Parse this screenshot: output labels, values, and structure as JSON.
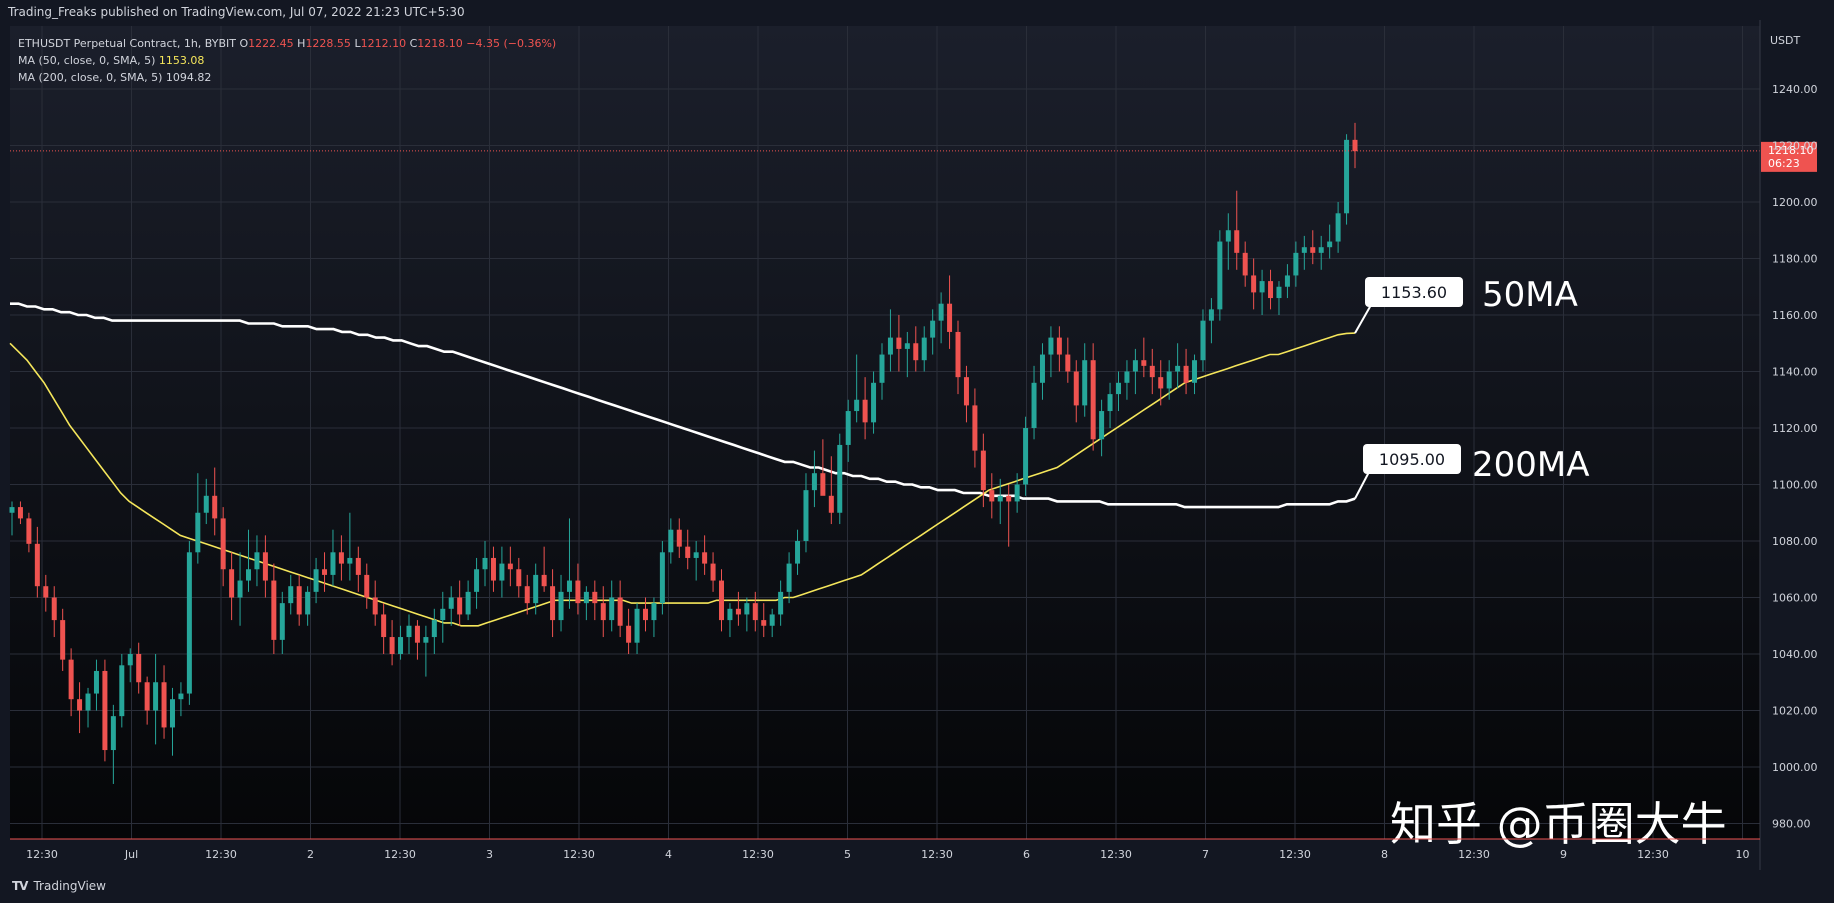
{
  "header": {
    "published": "Trading_Freaks published on TradingView.com, Jul 07, 2022 21:23 UTC+5:30"
  },
  "legend": {
    "symbol": "ETHUSDT Perpetual Contract, 1h, BYBIT",
    "o_label": "O",
    "o": "1222.45",
    "h_label": "H",
    "h": "1228.55",
    "l_label": "L",
    "l": "1212.10",
    "c_label": "C",
    "c": "1218.10",
    "change": "−4.35 (−0.36%)",
    "ma50_label": "MA (50, close, 0, SMA, 5)",
    "ma50_value": "1153.08",
    "ma200_label": "MA (200, close, 0, SMA, 5)",
    "ma200_value": "1094.82"
  },
  "footer": {
    "brand": "TradingView"
  },
  "watermark": "知乎 @币圈大牛",
  "colors": {
    "background": "#131722",
    "up": "#26a69a",
    "down": "#ef5350",
    "ma50": "#f5e65b",
    "ma200": "#ffffff",
    "grid": "#2a2e39",
    "price_label_bg": "#ef5350"
  },
  "chart_data": {
    "type": "candlestick",
    "title": "ETHUSDT Perpetual Contract, 1h, BYBIT",
    "currency": "USDT",
    "ylim": [
      980,
      1240
    ],
    "y_ticks": [
      "1240.00",
      "1220.00",
      "1200.00",
      "1180.00",
      "1160.00",
      "1140.00",
      "1120.00",
      "1100.00",
      "1080.00",
      "1060.00",
      "1040.00",
      "1020.00",
      "1000.00",
      "980.00"
    ],
    "x_ticks": [
      "12:30",
      "Jul",
      "12:30",
      "2",
      "12:30",
      "3",
      "12:30",
      "4",
      "12:30",
      "5",
      "12:30",
      "6",
      "12:30",
      "7",
      "12:30",
      "8",
      "12:30",
      "9",
      "12:30",
      "10"
    ],
    "last_price": {
      "value": "1218.10",
      "countdown": "06:23"
    },
    "grid": true,
    "candles": [
      [
        1090,
        1094,
        1082,
        1092
      ],
      [
        1092,
        1094,
        1086,
        1088
      ],
      [
        1088,
        1090,
        1076,
        1079
      ],
      [
        1079,
        1085,
        1060,
        1064
      ],
      [
        1064,
        1068,
        1055,
        1060
      ],
      [
        1060,
        1064,
        1046,
        1052
      ],
      [
        1052,
        1056,
        1034,
        1038
      ],
      [
        1038,
        1042,
        1018,
        1024
      ],
      [
        1024,
        1030,
        1012,
        1020
      ],
      [
        1020,
        1028,
        1014,
        1026
      ],
      [
        1026,
        1038,
        1020,
        1034
      ],
      [
        1034,
        1038,
        1002,
        1006
      ],
      [
        1006,
        1022,
        994,
        1018
      ],
      [
        1018,
        1040,
        1014,
        1036
      ],
      [
        1036,
        1042,
        1030,
        1040
      ],
      [
        1040,
        1044,
        1026,
        1030
      ],
      [
        1030,
        1032,
        1015,
        1020
      ],
      [
        1020,
        1040,
        1008,
        1030
      ],
      [
        1030,
        1036,
        1010,
        1014
      ],
      [
        1014,
        1028,
        1004,
        1024
      ],
      [
        1024,
        1030,
        1018,
        1026
      ],
      [
        1026,
        1080,
        1022,
        1076
      ],
      [
        1076,
        1104,
        1072,
        1090
      ],
      [
        1090,
        1102,
        1086,
        1096
      ],
      [
        1096,
        1106,
        1082,
        1088
      ],
      [
        1088,
        1092,
        1064,
        1070
      ],
      [
        1070,
        1076,
        1052,
        1060
      ],
      [
        1060,
        1076,
        1050,
        1066
      ],
      [
        1066,
        1084,
        1062,
        1070
      ],
      [
        1070,
        1082,
        1064,
        1076
      ],
      [
        1076,
        1082,
        1060,
        1066
      ],
      [
        1066,
        1072,
        1040,
        1045
      ],
      [
        1045,
        1062,
        1040,
        1058
      ],
      [
        1058,
        1068,
        1054,
        1064
      ],
      [
        1064,
        1068,
        1050,
        1054
      ],
      [
        1054,
        1064,
        1050,
        1062
      ],
      [
        1062,
        1074,
        1058,
        1070
      ],
      [
        1070,
        1076,
        1062,
        1068
      ],
      [
        1068,
        1084,
        1064,
        1076
      ],
      [
        1076,
        1082,
        1066,
        1072
      ],
      [
        1072,
        1090,
        1066,
        1074
      ],
      [
        1074,
        1078,
        1062,
        1068
      ],
      [
        1068,
        1072,
        1056,
        1060
      ],
      [
        1060,
        1066,
        1050,
        1054
      ],
      [
        1054,
        1058,
        1040,
        1046
      ],
      [
        1046,
        1052,
        1036,
        1040
      ],
      [
        1040,
        1050,
        1038,
        1046
      ],
      [
        1046,
        1054,
        1040,
        1050
      ],
      [
        1050,
        1052,
        1038,
        1044
      ],
      [
        1044,
        1050,
        1032,
        1046
      ],
      [
        1046,
        1056,
        1040,
        1052
      ],
      [
        1052,
        1062,
        1044,
        1056
      ],
      [
        1056,
        1064,
        1050,
        1060
      ],
      [
        1060,
        1066,
        1050,
        1054
      ],
      [
        1054,
        1066,
        1052,
        1062
      ],
      [
        1062,
        1074,
        1056,
        1070
      ],
      [
        1070,
        1080,
        1064,
        1074
      ],
      [
        1074,
        1078,
        1062,
        1066
      ],
      [
        1066,
        1078,
        1060,
        1072
      ],
      [
        1072,
        1078,
        1064,
        1070
      ],
      [
        1070,
        1074,
        1060,
        1064
      ],
      [
        1064,
        1068,
        1054,
        1058
      ],
      [
        1058,
        1072,
        1054,
        1068
      ],
      [
        1068,
        1078,
        1062,
        1064
      ],
      [
        1064,
        1070,
        1046,
        1052
      ],
      [
        1052,
        1068,
        1048,
        1062
      ],
      [
        1062,
        1088,
        1056,
        1066
      ],
      [
        1066,
        1072,
        1054,
        1058
      ],
      [
        1058,
        1064,
        1052,
        1062
      ],
      [
        1062,
        1066,
        1052,
        1058
      ],
      [
        1058,
        1064,
        1046,
        1052
      ],
      [
        1052,
        1066,
        1048,
        1060
      ],
      [
        1060,
        1066,
        1046,
        1050
      ],
      [
        1050,
        1056,
        1040,
        1044
      ],
      [
        1044,
        1058,
        1040,
        1056
      ],
      [
        1056,
        1060,
        1048,
        1052
      ],
      [
        1052,
        1060,
        1046,
        1058
      ],
      [
        1058,
        1080,
        1054,
        1076
      ],
      [
        1076,
        1088,
        1072,
        1084
      ],
      [
        1084,
        1088,
        1074,
        1078
      ],
      [
        1078,
        1084,
        1070,
        1074
      ],
      [
        1074,
        1080,
        1066,
        1076
      ],
      [
        1076,
        1082,
        1068,
        1072
      ],
      [
        1072,
        1076,
        1062,
        1066
      ],
      [
        1066,
        1070,
        1048,
        1052
      ],
      [
        1052,
        1058,
        1046,
        1056
      ],
      [
        1056,
        1062,
        1050,
        1054
      ],
      [
        1054,
        1060,
        1048,
        1058
      ],
      [
        1058,
        1062,
        1048,
        1052
      ],
      [
        1052,
        1058,
        1046,
        1050
      ],
      [
        1050,
        1056,
        1046,
        1054
      ],
      [
        1054,
        1066,
        1050,
        1062
      ],
      [
        1062,
        1076,
        1058,
        1072
      ],
      [
        1072,
        1084,
        1068,
        1080
      ],
      [
        1080,
        1104,
        1076,
        1098
      ],
      [
        1098,
        1112,
        1092,
        1104
      ],
      [
        1104,
        1116,
        1098,
        1096
      ],
      [
        1096,
        1110,
        1086,
        1090
      ],
      [
        1090,
        1118,
        1086,
        1114
      ],
      [
        1114,
        1130,
        1108,
        1126
      ],
      [
        1126,
        1146,
        1122,
        1130
      ],
      [
        1130,
        1138,
        1116,
        1122
      ],
      [
        1122,
        1140,
        1118,
        1136
      ],
      [
        1136,
        1150,
        1130,
        1146
      ],
      [
        1146,
        1162,
        1140,
        1152
      ],
      [
        1152,
        1160,
        1140,
        1148
      ],
      [
        1148,
        1154,
        1138,
        1150
      ],
      [
        1150,
        1156,
        1140,
        1144
      ],
      [
        1144,
        1156,
        1140,
        1152
      ],
      [
        1152,
        1162,
        1146,
        1158
      ],
      [
        1158,
        1168,
        1150,
        1164
      ],
      [
        1164,
        1174,
        1148,
        1154
      ],
      [
        1154,
        1158,
        1132,
        1138
      ],
      [
        1138,
        1142,
        1122,
        1128
      ],
      [
        1128,
        1134,
        1106,
        1112
      ],
      [
        1112,
        1118,
        1092,
        1098
      ],
      [
        1098,
        1104,
        1088,
        1094
      ],
      [
        1094,
        1102,
        1086,
        1096
      ],
      [
        1096,
        1100,
        1078,
        1094
      ],
      [
        1094,
        1104,
        1090,
        1100
      ],
      [
        1100,
        1124,
        1096,
        1120
      ],
      [
        1120,
        1142,
        1116,
        1136
      ],
      [
        1136,
        1150,
        1130,
        1146
      ],
      [
        1146,
        1156,
        1138,
        1152
      ],
      [
        1152,
        1156,
        1140,
        1146
      ],
      [
        1146,
        1152,
        1136,
        1140
      ],
      [
        1140,
        1144,
        1122,
        1128
      ],
      [
        1128,
        1150,
        1124,
        1144
      ],
      [
        1144,
        1150,
        1112,
        1116
      ],
      [
        1116,
        1130,
        1110,
        1126
      ],
      [
        1126,
        1136,
        1120,
        1132
      ],
      [
        1132,
        1140,
        1126,
        1136
      ],
      [
        1136,
        1144,
        1130,
        1140
      ],
      [
        1140,
        1148,
        1132,
        1144
      ],
      [
        1144,
        1152,
        1138,
        1142
      ],
      [
        1142,
        1148,
        1132,
        1138
      ],
      [
        1138,
        1144,
        1128,
        1134
      ],
      [
        1134,
        1144,
        1130,
        1140
      ],
      [
        1140,
        1150,
        1134,
        1142
      ],
      [
        1142,
        1148,
        1132,
        1136
      ],
      [
        1136,
        1146,
        1132,
        1144
      ],
      [
        1144,
        1162,
        1140,
        1158
      ],
      [
        1158,
        1166,
        1150,
        1162
      ],
      [
        1162,
        1190,
        1158,
        1186
      ],
      [
        1186,
        1196,
        1176,
        1190
      ],
      [
        1190,
        1204,
        1176,
        1182
      ],
      [
        1182,
        1186,
        1170,
        1174
      ],
      [
        1174,
        1180,
        1162,
        1168
      ],
      [
        1168,
        1176,
        1160,
        1172
      ],
      [
        1172,
        1176,
        1162,
        1166
      ],
      [
        1166,
        1172,
        1160,
        1170
      ],
      [
        1170,
        1178,
        1166,
        1174
      ],
      [
        1174,
        1186,
        1170,
        1182
      ],
      [
        1182,
        1188,
        1176,
        1184
      ],
      [
        1184,
        1190,
        1178,
        1182
      ],
      [
        1182,
        1188,
        1176,
        1184
      ],
      [
        1184,
        1192,
        1180,
        1186
      ],
      [
        1186,
        1200,
        1182,
        1196
      ],
      [
        1196,
        1224,
        1192,
        1222
      ],
      [
        1222,
        1228,
        1212,
        1218
      ]
    ],
    "series": [
      {
        "name": "MA (50, close, 0, SMA, 5)",
        "color": "#f5e65b",
        "values": [
          1150,
          1147,
          1144,
          1140,
          1136,
          1131,
          1126,
          1121,
          1117,
          1113,
          1109,
          1105,
          1101,
          1097,
          1094,
          1092,
          1090,
          1088,
          1086,
          1084,
          1082,
          1081,
          1080,
          1079,
          1078,
          1077,
          1076,
          1075,
          1074,
          1073,
          1072,
          1071,
          1070,
          1069,
          1068,
          1067,
          1066,
          1065,
          1064,
          1063,
          1062,
          1061,
          1060,
          1059,
          1058,
          1057,
          1056,
          1055,
          1054,
          1053,
          1052,
          1051,
          1051,
          1050,
          1050,
          1050,
          1051,
          1052,
          1053,
          1054,
          1055,
          1056,
          1057,
          1058,
          1059,
          1059,
          1059,
          1059,
          1059,
          1059,
          1059,
          1059,
          1059,
          1058,
          1058,
          1058,
          1058,
          1058,
          1058,
          1058,
          1058,
          1058,
          1058,
          1059,
          1059,
          1059,
          1059,
          1059,
          1059,
          1059,
          1059,
          1060,
          1060,
          1061,
          1062,
          1063,
          1064,
          1065,
          1066,
          1067,
          1068,
          1070,
          1072,
          1074,
          1076,
          1078,
          1080,
          1082,
          1084,
          1086,
          1088,
          1090,
          1092,
          1094,
          1096,
          1098,
          1099,
          1100,
          1101,
          1102,
          1103,
          1104,
          1105,
          1106,
          1108,
          1110,
          1112,
          1114,
          1116,
          1118,
          1120,
          1122,
          1124,
          1126,
          1128,
          1130,
          1132,
          1134,
          1136,
          1137,
          1138,
          1139,
          1140,
          1141,
          1142,
          1143,
          1144,
          1145,
          1146,
          1146,
          1147,
          1148,
          1149,
          1150,
          1151,
          1152,
          1153,
          1153.5,
          1153.6
        ]
      },
      {
        "name": "MA (200, close, 0, SMA, 5)",
        "color": "#ffffff",
        "values": [
          1164,
          1164,
          1163,
          1163,
          1162,
          1162,
          1161,
          1161,
          1160,
          1160,
          1159,
          1159,
          1158,
          1158,
          1158,
          1158,
          1158,
          1158,
          1158,
          1158,
          1158,
          1158,
          1158,
          1158,
          1158,
          1158,
          1158,
          1158,
          1157,
          1157,
          1157,
          1157,
          1156,
          1156,
          1156,
          1156,
          1155,
          1155,
          1155,
          1154,
          1154,
          1153,
          1153,
          1152,
          1152,
          1151,
          1151,
          1150,
          1149,
          1149,
          1148,
          1147,
          1147,
          1146,
          1145,
          1144,
          1143,
          1142,
          1141,
          1140,
          1139,
          1138,
          1137,
          1136,
          1135,
          1134,
          1133,
          1132,
          1131,
          1130,
          1129,
          1128,
          1127,
          1126,
          1125,
          1124,
          1123,
          1122,
          1121,
          1120,
          1119,
          1118,
          1117,
          1116,
          1115,
          1114,
          1113,
          1112,
          1111,
          1110,
          1109,
          1108,
          1108,
          1107,
          1106,
          1106,
          1105,
          1104,
          1104,
          1103,
          1103,
          1102,
          1102,
          1101,
          1101,
          1100,
          1100,
          1099,
          1099,
          1098,
          1098,
          1098,
          1097,
          1097,
          1097,
          1096,
          1096,
          1096,
          1096,
          1095,
          1095,
          1095,
          1095,
          1094,
          1094,
          1094,
          1094,
          1094,
          1094,
          1093,
          1093,
          1093,
          1093,
          1093,
          1093,
          1093,
          1093,
          1093,
          1092,
          1092,
          1092,
          1092,
          1092,
          1092,
          1092,
          1092,
          1092,
          1092,
          1092,
          1092,
          1093,
          1093,
          1093,
          1093,
          1093,
          1093,
          1094,
          1094,
          1095
        ]
      }
    ],
    "annotations": [
      {
        "label_box": "1153.60",
        "text": "50MA",
        "anchor_x_index": 160,
        "anchor_value": 1153.6
      },
      {
        "label_box": "1095.00",
        "text": "200MA",
        "anchor_x_index": 160,
        "anchor_value": 1095.0
      }
    ]
  }
}
